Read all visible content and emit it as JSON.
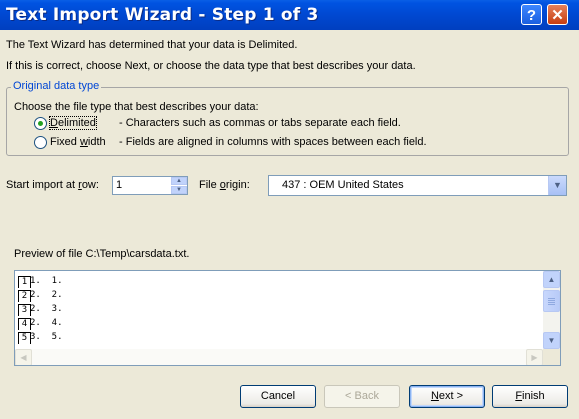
{
  "window": {
    "title": "Text Import Wizard - Step 1 of 3",
    "help_glyph": "?",
    "close_glyph": "✕"
  },
  "intro": {
    "line1": "The Text Wizard has determined that your data is Delimited.",
    "line2": "If this is correct, choose Next, or choose the data type that best describes your data."
  },
  "original_data_type": {
    "legend": "Original data type",
    "prompt": "Choose the file type that best describes your data:",
    "options": [
      {
        "label_pre": "",
        "label_u": "D",
        "label_post": "elimited",
        "description": "- Characters such as commas or tabs separate each field.",
        "checked": true
      },
      {
        "label_pre": "Fixed ",
        "label_u": "w",
        "label_post": "idth",
        "description": "- Fields are aligned in columns with spaces between each field.",
        "checked": false
      }
    ]
  },
  "start_import": {
    "label_pre": "Start import at ",
    "label_u": "r",
    "label_post": "ow:",
    "value": "1"
  },
  "file_origin": {
    "label_pre": "File ",
    "label_u": "o",
    "label_post": "rigin:",
    "value": "437 : OEM United States"
  },
  "preview": {
    "label": "Preview of file C:\\Temp\\carsdata.txt.",
    "rows": [
      {
        "num": "1",
        "text": "1.  1."
      },
      {
        "num": "2",
        "text": "2.  2."
      },
      {
        "num": "3",
        "text": "2.  3."
      },
      {
        "num": "4",
        "text": "2.  4."
      },
      {
        "num": "5",
        "text": "3.  5."
      }
    ]
  },
  "buttons": {
    "cancel": "Cancel",
    "back": "< Back",
    "next_u": "N",
    "next_post": "ext >",
    "finish_u": "F",
    "finish_post": "inish"
  },
  "colors": {
    "title_bar": "#0048d1",
    "dialog_bg": "#ece9d8",
    "legend_text": "#0046d5",
    "radio_dot": "#21a121"
  }
}
